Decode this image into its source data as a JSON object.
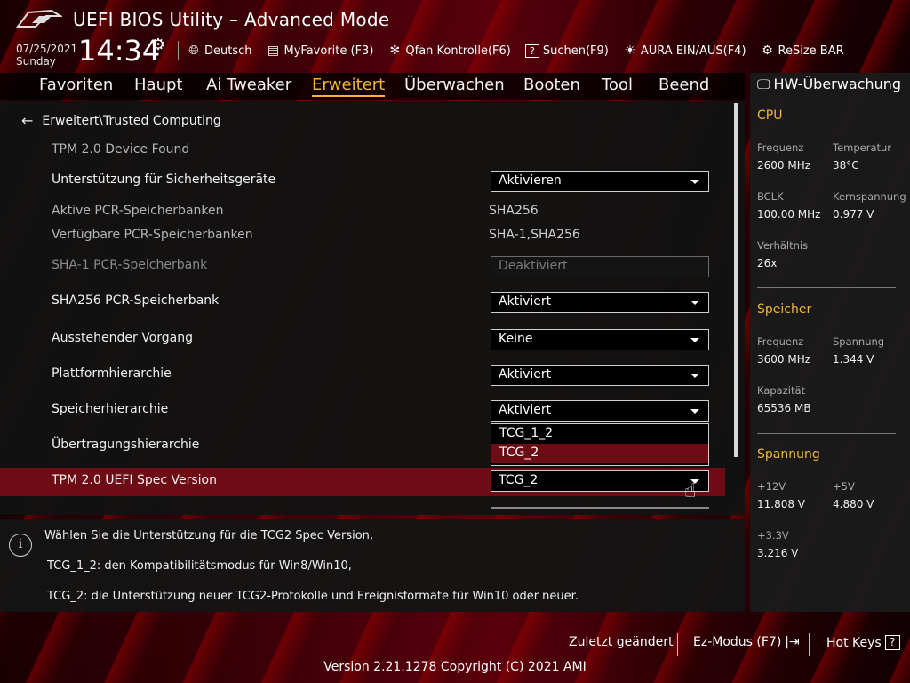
{
  "header": {
    "title": "UEFI BIOS Utility – Advanced Mode",
    "date": "07/25/2021",
    "day": "Sunday",
    "time": "14:34",
    "tools": [
      {
        "icon": "globe-icon",
        "label": "Deutsch"
      },
      {
        "icon": "myfavorite-icon",
        "label": "MyFavorite (F3)"
      },
      {
        "icon": "fan-icon",
        "label": "Qfan Kontrolle(F6)"
      },
      {
        "icon": "search-help-icon",
        "label": "Suchen(F9)"
      },
      {
        "icon": "aura-icon",
        "label": "AURA EIN/AUS(F4)"
      },
      {
        "icon": "resize-bar-icon",
        "label": "ReSize BAR"
      }
    ]
  },
  "nav": {
    "tabs": [
      "Favoriten",
      "Haupt",
      "Ai Tweaker",
      "Erweitert",
      "Überwachen",
      "Booten",
      "Tool",
      "Beend"
    ],
    "active": "Erweitert"
  },
  "main": {
    "breadcrumb": "Erweitert\\Trusted Computing",
    "device_found": "TPM 2.0 Device Found",
    "rows": {
      "security_support": {
        "label": "Unterstützung für Sicherheitsgeräte",
        "value": "Aktivieren"
      },
      "active_pcr": {
        "label": "Aktive PCR-Speicherbanken",
        "value": "SHA256"
      },
      "available_pcr": {
        "label": "Verfügbare PCR-Speicherbanken",
        "value": "SHA-1,SHA256"
      },
      "sha1_bank": {
        "label": "SHA-1 PCR-Speicherbank",
        "value": "Deaktiviert"
      },
      "sha256_bank": {
        "label": "SHA256 PCR-Speicherbank",
        "value": "Aktiviert"
      },
      "pending_op": {
        "label": "Ausstehender Vorgang",
        "value": "Keine"
      },
      "platform_hier": {
        "label": "Plattformhierarchie",
        "value": "Aktiviert"
      },
      "storage_hier": {
        "label": "Speicherhierarchie",
        "value": "Aktiviert"
      },
      "endorsement_hier": {
        "label": "Übertragungshierarchie"
      },
      "spec_version": {
        "label": "TPM 2.0 UEFI Spec Version",
        "value": "TCG_2"
      }
    },
    "popup_options": [
      "TCG_1_2",
      "TCG_2"
    ]
  },
  "help": {
    "line1": "Wählen Sie die Unterstützung für die TCG2 Spec Version,",
    "line2": "TCG_1_2: den Kompatibilitätsmodus für Win8/Win10,",
    "line3": "TCG_2: die Unterstützung neuer TCG2-Protokolle und Ereignisformate für Win10 oder neuer."
  },
  "hw": {
    "title": "HW-Überwachung",
    "cpu": {
      "section": "CPU",
      "freq_label": "Frequenz",
      "freq": "2600 MHz",
      "temp_label": "Temperatur",
      "temp": "38°C",
      "bclk_label": "BCLK",
      "bclk": "100.00 MHz",
      "core_label": "Kernspannung",
      "core": "0.977 V",
      "ratio_label": "Verhältnis",
      "ratio": "26x"
    },
    "memory": {
      "section": "Speicher",
      "freq_label": "Frequenz",
      "freq": "3600 MHz",
      "volt_label": "Spannung",
      "volt": "1.344 V",
      "cap_label": "Kapazität",
      "cap": "65536 MB"
    },
    "voltage": {
      "section": "Spannung",
      "v12_label": "+12V",
      "v12": "11.808 V",
      "v5_label": "+5V",
      "v5": "4.880 V",
      "v33_label": "+3.3V",
      "v33": "3.216 V"
    }
  },
  "footer": {
    "last_changed": "Zuletzt geändert",
    "ez_mode": "Ez-Modus (F7)",
    "hot_keys": "Hot Keys",
    "version": "Version 2.21.1278 Copyright (C) 2021 AMI"
  },
  "colors": {
    "accent": "#f2b632",
    "selection": "#6d0c15"
  }
}
